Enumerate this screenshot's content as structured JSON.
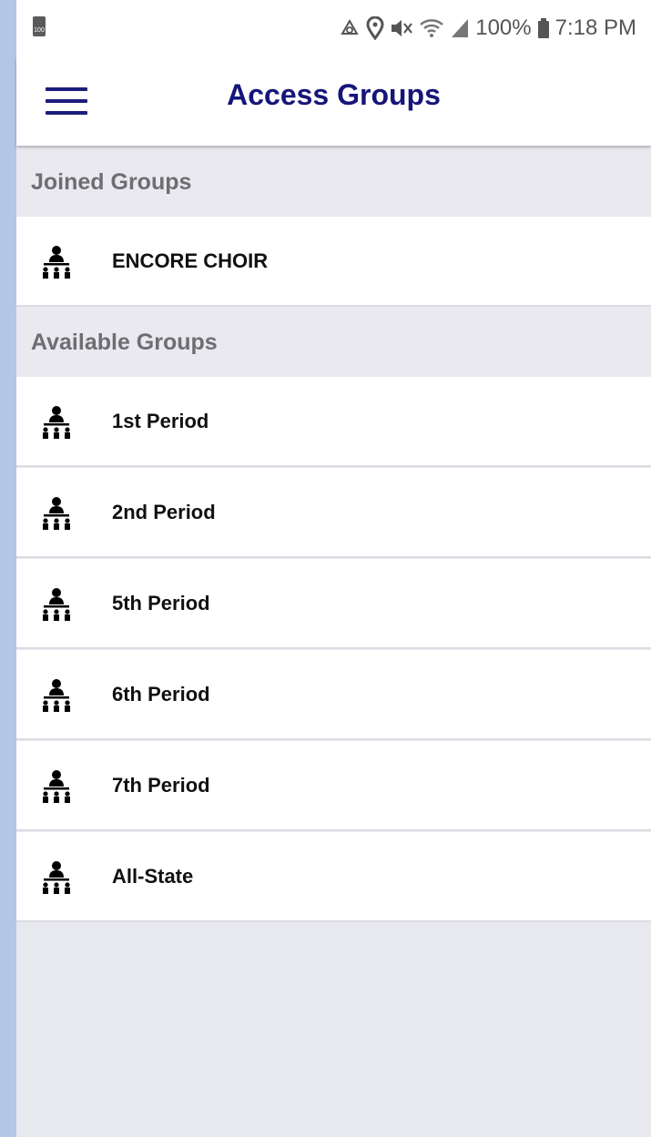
{
  "status_bar": {
    "battery_icon_label": "100",
    "battery_percent": "100%",
    "time": "7:18 PM",
    "icons": [
      "sync-icon",
      "location-icon",
      "mute-icon",
      "wifi-icon",
      "signal-icon",
      "battery-icon"
    ]
  },
  "header": {
    "title": "Access Groups",
    "menu_icon": "hamburger-menu-icon"
  },
  "sections": {
    "joined": {
      "title": "Joined Groups",
      "items": [
        {
          "label": "ENCORE CHOIR",
          "icon": "group-hierarchy-icon"
        }
      ]
    },
    "available": {
      "title": "Available Groups",
      "items": [
        {
          "label": "1st Period",
          "icon": "group-hierarchy-icon"
        },
        {
          "label": "2nd Period",
          "icon": "group-hierarchy-icon"
        },
        {
          "label": "5th Period",
          "icon": "group-hierarchy-icon"
        },
        {
          "label": "6th Period",
          "icon": "group-hierarchy-icon"
        },
        {
          "label": "7th Period",
          "icon": "group-hierarchy-icon"
        },
        {
          "label": "All-State",
          "icon": "group-hierarchy-icon"
        }
      ]
    }
  },
  "colors": {
    "title": "#16157a",
    "menu_icon": "#1c1c7c",
    "section_text": "#6d6d72",
    "background": "#e8e8ef"
  }
}
